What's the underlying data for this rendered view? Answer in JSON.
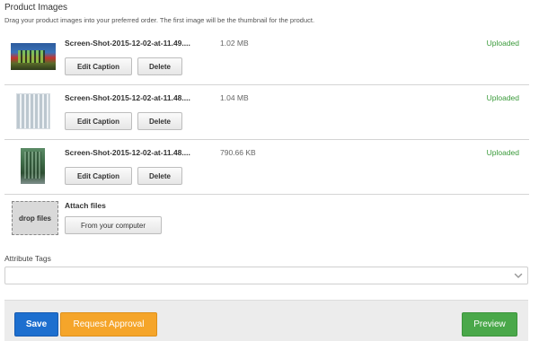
{
  "section": {
    "title": "Product Images",
    "help": "Drag your product images into your preferred order. The first image will be the thumbnail for the product."
  },
  "uploads": [
    {
      "file_name": "Screen-Shot-2015-12-02-at-11.49....",
      "size": "1.02 MB",
      "status": "Uploaded",
      "caption_label": "Edit Caption",
      "delete_label": "Delete"
    },
    {
      "file_name": "Screen-Shot-2015-12-02-at-11.48....",
      "size": "1.04 MB",
      "status": "Uploaded",
      "caption_label": "Edit Caption",
      "delete_label": "Delete"
    },
    {
      "file_name": "Screen-Shot-2015-12-02-at-11.48....",
      "size": "790.66 KB",
      "status": "Uploaded",
      "caption_label": "Edit Caption",
      "delete_label": "Delete"
    }
  ],
  "dropzone": {
    "label": "drop files",
    "attach_label": "Attach files",
    "computer_button": "From your computer"
  },
  "attribute_tags": {
    "label": "Attribute Tags",
    "value": ""
  },
  "footer": {
    "save_label": "Save",
    "approval_label": "Request Approval",
    "preview_label": "Preview"
  },
  "colors": {
    "save": "#1d6fcf",
    "approval": "#f5a52a",
    "preview": "#4aa84a",
    "uploaded": "#3a9a3a"
  },
  "icons": {
    "select_arrow": "chevron-down-icon"
  }
}
